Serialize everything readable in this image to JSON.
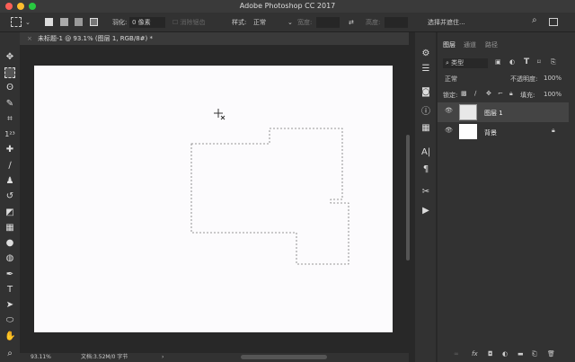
{
  "window": {
    "title": "Adobe Photoshop CC 2017"
  },
  "options": {
    "feather_label": "羽化:",
    "feather_value": "0 像素",
    "antialias_label": "消除锯齿",
    "style_label": "样式:",
    "style_value": "正常",
    "width_label": "宽度:",
    "height_label": "高度:",
    "select_mask_button": "选择并遮住..."
  },
  "document": {
    "tab_title": "未标题-1 @ 93.1% (图层 1, RGB/8#) *",
    "zoom": "93.11%",
    "doc_info": "文档:3.52M/0 字节"
  },
  "panel": {
    "tabs": [
      "图层",
      "通道",
      "路径"
    ],
    "filter_kind": "类型",
    "blend_mode": "正常",
    "opacity_label": "不透明度:",
    "opacity_value": "100%",
    "lock_label": "锁定:",
    "fill_label": "填充:",
    "fill_value": "100%",
    "layers": [
      {
        "name": "图层 1",
        "visible": true,
        "selected": true
      },
      {
        "name": "背景",
        "visible": true,
        "locked": true
      }
    ]
  },
  "colors": {
    "accent": "#3a3a3a",
    "canvas": "#fcfbfd"
  }
}
